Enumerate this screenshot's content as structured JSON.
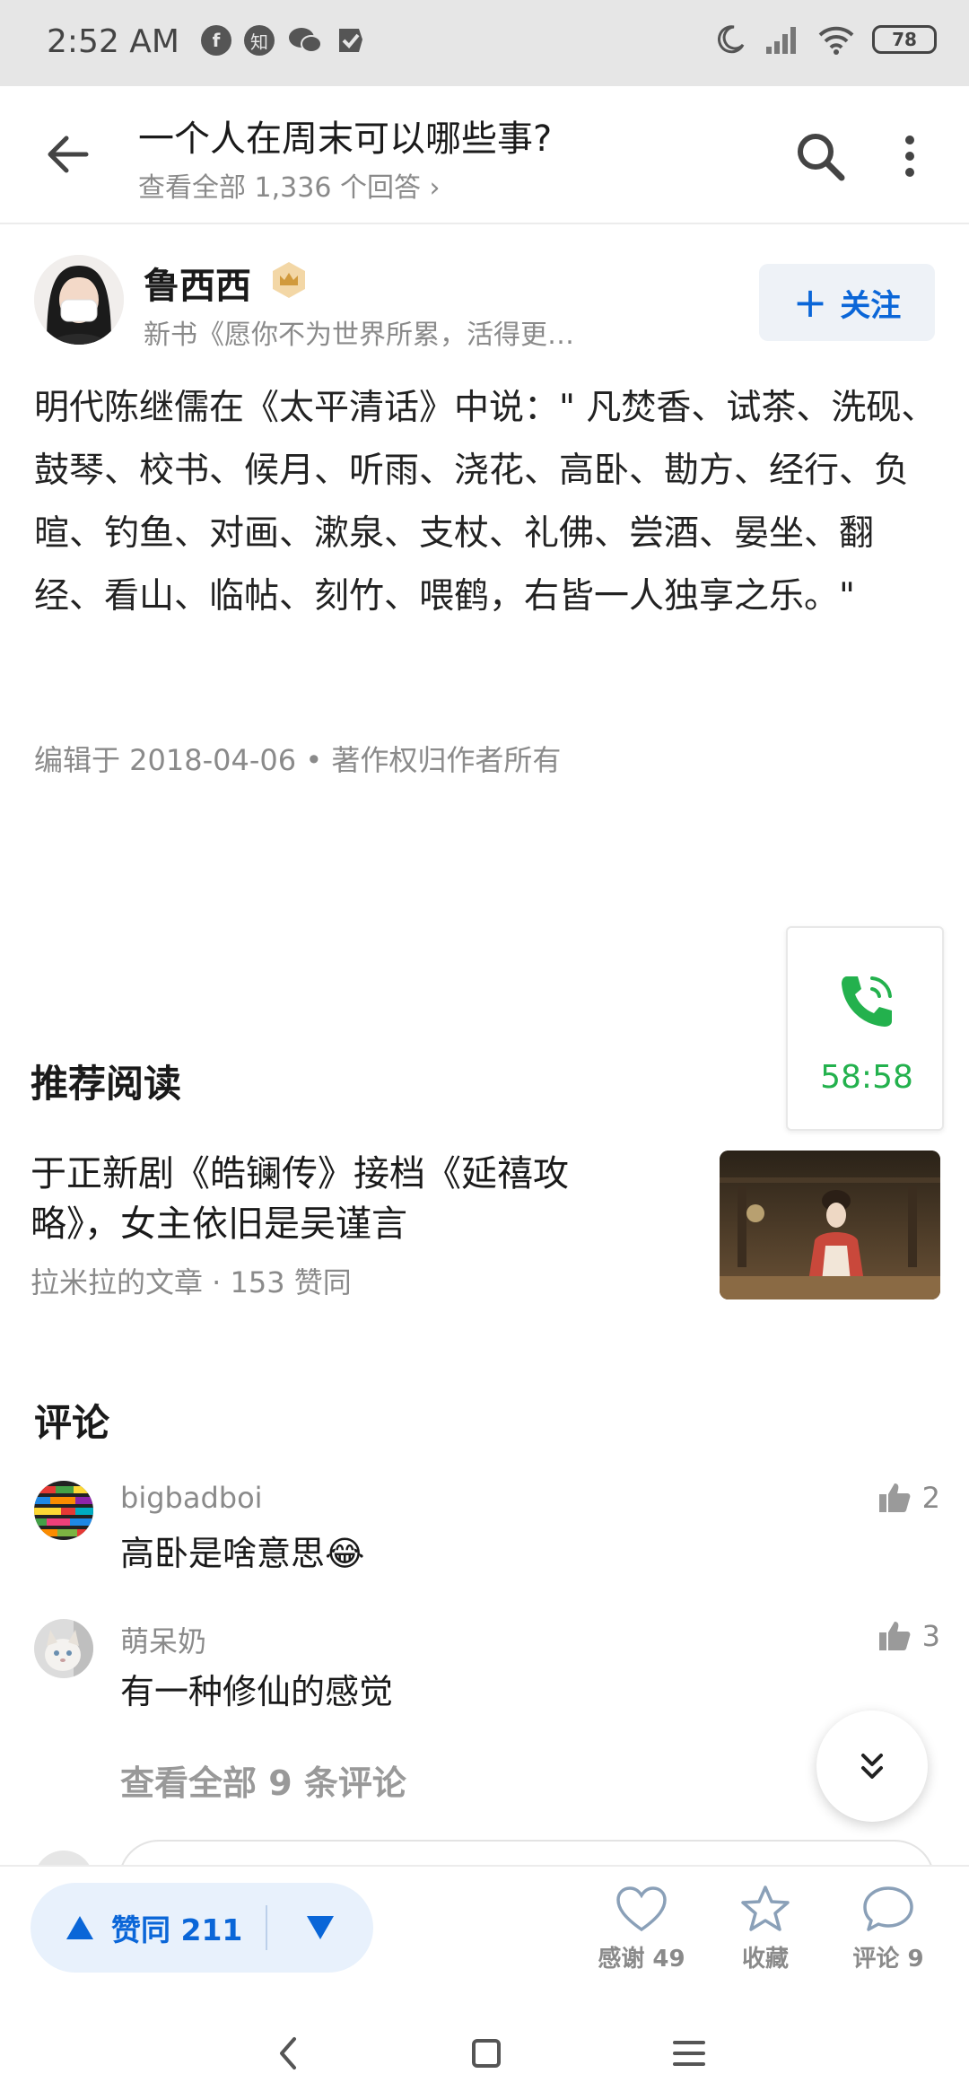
{
  "status_bar": {
    "time": "2:52 AM",
    "left_icons": [
      "facebook-icon",
      "zhihu-icon",
      "wechat-icon",
      "check-flag-icon"
    ],
    "zhihu_glyph": "知",
    "right_icons": [
      "moon-icon",
      "signal-icon",
      "wifi-icon"
    ],
    "battery": "78"
  },
  "header": {
    "question_title": "一个人在周末可以哪些事?",
    "view_all_answers": "查看全部 1,336 个回答 ›"
  },
  "author": {
    "name": "鲁西西",
    "bio": "新书《愿你不为世界所累，活得更…",
    "follow_label": "关注",
    "follow_icon": "+"
  },
  "answer": {
    "text": "明代陈继儒在《太平清话》中说：\" 凡焚香、试茶、洗砚、鼓琴、校书、候月、听雨、浇花、高卧、勘方、经行、负暄、钓鱼、对画、漱泉、支杖、礼佛、尝酒、晏坐、翻经、看山、临帖、刻竹、喂鹤，右皆一人独享之乐。\"",
    "edit_meta": "编辑于 2018-04-06 • 著作权归作者所有"
  },
  "call_widget": {
    "timer": "58:58",
    "color": "#23b14d"
  },
  "recommended": {
    "section_title": "推荐阅读",
    "article_title": "于正新剧《皓镧传》接档《延禧攻略》，女主依旧是吴谨言",
    "article_meta": "拉米拉的文章 · 153 赞同"
  },
  "comments": {
    "section_title": "评论",
    "items": [
      {
        "user": "bigbadboi",
        "text": "高卧是啥意思😂",
        "likes": "2"
      },
      {
        "user": "萌呆奶",
        "text": "有一种修仙的感觉",
        "likes": "3"
      }
    ],
    "view_all": "查看全部 9 条评论"
  },
  "actions": {
    "upvote_label": "赞同 211",
    "thanks_label": "感谢 49",
    "collect_label": "收藏",
    "comment_label": "评论 9",
    "accent": "#0a66d8"
  }
}
